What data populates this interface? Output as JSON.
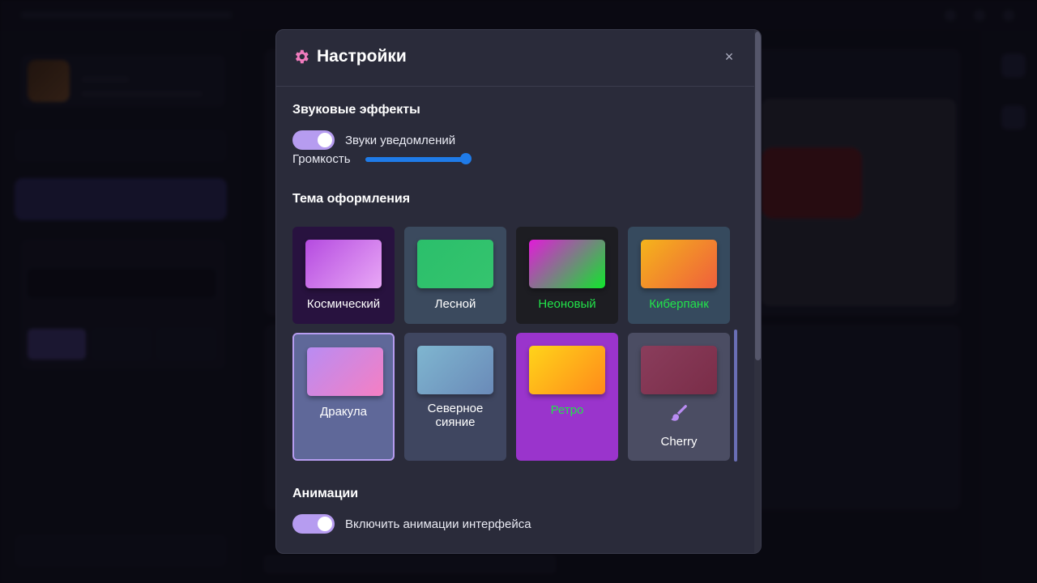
{
  "modal": {
    "title": "Настройки",
    "close_label": "×",
    "icon": "gear-icon"
  },
  "sound": {
    "section_title": "Звуковые эффекты",
    "notifications_label": "Звуки уведомлений",
    "notifications_enabled": true,
    "volume_label": "Громкость",
    "volume_value": 0.95
  },
  "theme": {
    "section_title": "Тема оформления",
    "items": [
      {
        "label": "Космический",
        "label_color": "#ffffff",
        "card_bg": "#28123f",
        "swatch": [
          "#b54be0",
          "#e9a8f6"
        ]
      },
      {
        "label": "Лесной",
        "label_color": "#ffffff",
        "card_bg": "#3b4a5e",
        "swatch": [
          "#2bbf6b",
          "#35c46e"
        ]
      },
      {
        "label": "Неоновый",
        "label_color": "#22e34a",
        "card_bg": "#1d1d22",
        "swatch": [
          "#e21bd9",
          "#10e62c"
        ]
      },
      {
        "label": "Киберпанк",
        "label_color": "#22e34a",
        "card_bg": "#364a5e",
        "swatch": [
          "#f5b41b",
          "#ef5f3c"
        ]
      },
      {
        "label": "Дракула",
        "label_color": "#ffffff",
        "card_bg": "#5f6899",
        "swatch": [
          "#b98cf3",
          "#f57fc3"
        ],
        "selected": true
      },
      {
        "label": "Северное сияние",
        "label_color": "#ffffff",
        "card_bg": "#3f4660",
        "swatch": [
          "#7fb6d0",
          "#6a8ab8"
        ]
      },
      {
        "label": "Ретро",
        "label_color": "#22e34a",
        "card_bg": "#9a34cc",
        "swatch": [
          "#ffd41a",
          "#ff8a1a"
        ]
      },
      {
        "label": "Cherry",
        "label_color": "#ffffff",
        "card_bg": "#4b4d63",
        "swatch": [
          "#8a3d5c",
          "#7a2d48"
        ],
        "icon": "brush-icon"
      }
    ]
  },
  "animations": {
    "section_title": "Анимации",
    "toggle_label": "Включить анимации интерфейса",
    "enabled": true
  },
  "colors": {
    "accent": "#b69cf0",
    "slider": "#1f7be8",
    "modal_bg": "#2a2b3a",
    "gear": "#f07bbd"
  }
}
